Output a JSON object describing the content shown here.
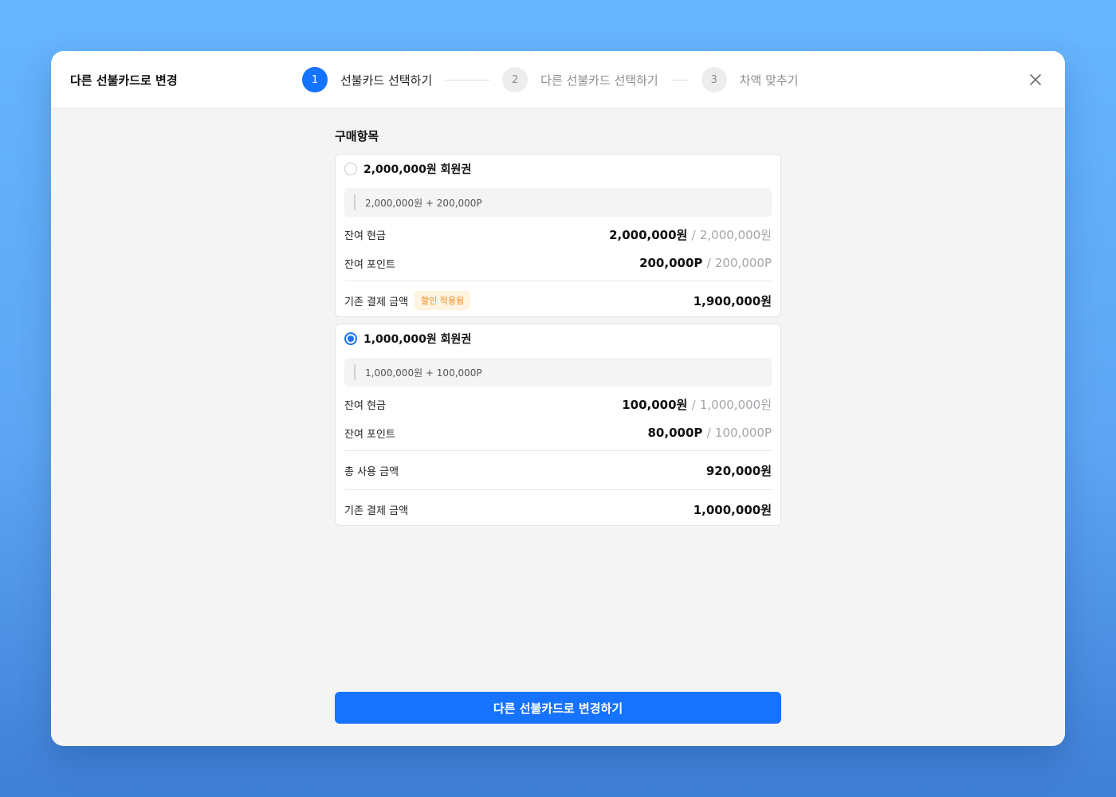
{
  "modal": {
    "title": "다른 선불카드로 변경",
    "steps": [
      {
        "number": "1",
        "label": "선불카드 선택하기"
      },
      {
        "number": "2",
        "label": "다른 선불카드 선택하기"
      },
      {
        "number": "3",
        "label": "차액 맞추기"
      }
    ],
    "active_step": 1,
    "close_icon": "close-icon"
  },
  "purchase": {
    "section_title": "구매항목",
    "cards": [
      {
        "title": "2,000,000원 회원권",
        "selected": false,
        "description": "2,000,000원 + 200,000P",
        "cash_label": "잔여 현금",
        "cash_remaining": "2,000,000원",
        "cash_total": "2,000,000원",
        "points_label": "잔여 포인트",
        "points_remaining": "200,000P",
        "points_total": "200,000P",
        "payment_label": "기존 결제 금액",
        "discount_badge": "할인 적용됨",
        "payment_amount": "1,900,000원"
      },
      {
        "title": "1,000,000원 회원권",
        "selected": true,
        "description": "1,000,000원 + 100,000P",
        "cash_label": "잔여 현금",
        "cash_remaining": "100,000원",
        "cash_total": "1,000,000원",
        "points_label": "잔여 포인트",
        "points_remaining": "80,000P",
        "points_total": "100,000P",
        "used_label": "총 사용 금액",
        "used_amount": "920,000원",
        "payment_label": "기존 결제 금액",
        "payment_amount": "1,000,000원"
      }
    ],
    "separator": "/"
  },
  "footer": {
    "submit_label": "다른 선불카드로 변경하기"
  },
  "colors": {
    "primary": "#1673ff",
    "badge_text": "#ef8a1d",
    "badge_bg": "#fff4e0"
  }
}
